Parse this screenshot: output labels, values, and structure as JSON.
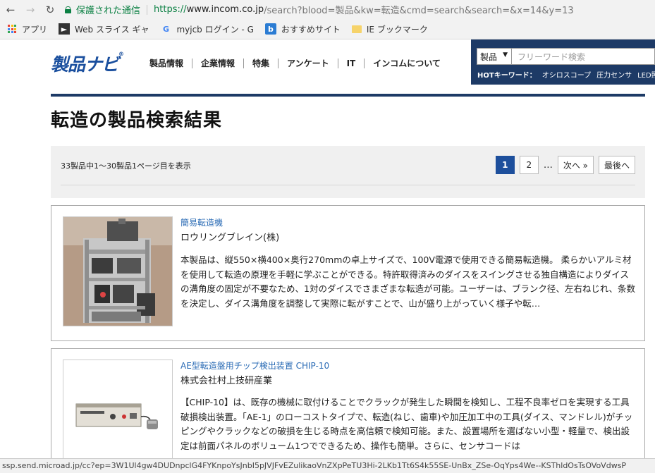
{
  "browser": {
    "secure_text": "保護された通信",
    "url_scheme": "https://",
    "url_host": "www.incom.co.jp",
    "url_rest": "/search?blood=製品&kw=転造&cmd=search&search=&x=14&y=13",
    "bookmarks": [
      {
        "label": "アプリ",
        "icon": "apps-grid-icon"
      },
      {
        "label": "Web スライス ギャ",
        "icon": "web-slice-icon"
      },
      {
        "label": "myjcb ログイン - G",
        "icon": "google-icon"
      },
      {
        "label": "おすすめサイト",
        "icon": "bing-icon"
      },
      {
        "label": "IE ブックマーク",
        "icon": "folder-icon"
      }
    ],
    "status_url": "ssp.send.microad.jp/cc?ep=3W1Ul4gw4DUDnpclG4FYKnpoYsJnbI5pJVJFvEZulikaoVnZXpPeTU3Hi-2LKb1Tt6S4k55SE-UnBx_ZSe-OqYps4We--KSThldOsTsOVoVdwsP"
  },
  "header": {
    "logo_text": "製品ナビ",
    "logo_mark": "®",
    "nav": [
      "製品情報",
      "企業情報",
      "特集",
      "アンケート",
      "IT",
      "インコムについて"
    ],
    "search": {
      "category": "製品",
      "placeholder": "フリーワード検索",
      "hot_label": "HOTキーワード：",
      "hot_keywords": [
        "オシロスコープ",
        "圧力センサ",
        "LED照明"
      ]
    }
  },
  "page": {
    "title": "転造の製品検索結果",
    "result_count": "33製品中1〜30製品1ページ目を表示",
    "pager": {
      "pages": [
        "1",
        "2"
      ],
      "current": "1",
      "ellipsis": "…",
      "next": "次へ »",
      "last": "最後へ"
    }
  },
  "results": [
    {
      "title": "簡易転造機",
      "company": "ロウリングブレイン(株)",
      "description": "本製品は、縦550×横400×奥行270mmの卓上サイズで、100V電源で使用できる簡易転造機。 柔らかいアルミ材を使用して転造の原理を手軽に学ぶことができる。特許取得済みのダイスをスイングさせる独自構造によりダイスの溝角度の固定が不要なため、1対のダイスでさまざまな転造が可能。ユーザーは、ブランク径、左右ねじれ、条数を決定し、ダイス溝角度を調整して実際に転がすことで、山が盛り上がっていく様子や転…"
    },
    {
      "title": "AE型転造盤用チップ検出装置 CHIP-10",
      "company": "株式会社村上技研産業",
      "description": "【CHIP-10】は、既存の機械に取付けることでクラックが発生した瞬間を検知し、工程不良率ゼロを実現する工具破損検出装置。「AE-1」のローコストタイプで、転造(ねじ、歯車)や加圧加工中の工具(ダイス、マンドレル)がチッピングやクラックなどの破損を生じる時点を高信頼で検知可能。また、設置場所を選ばない小型・軽量で、検出設定は前面パネルのボリューム1つでできるため、操作も簡単。さらに、センサコードは"
    }
  ]
}
